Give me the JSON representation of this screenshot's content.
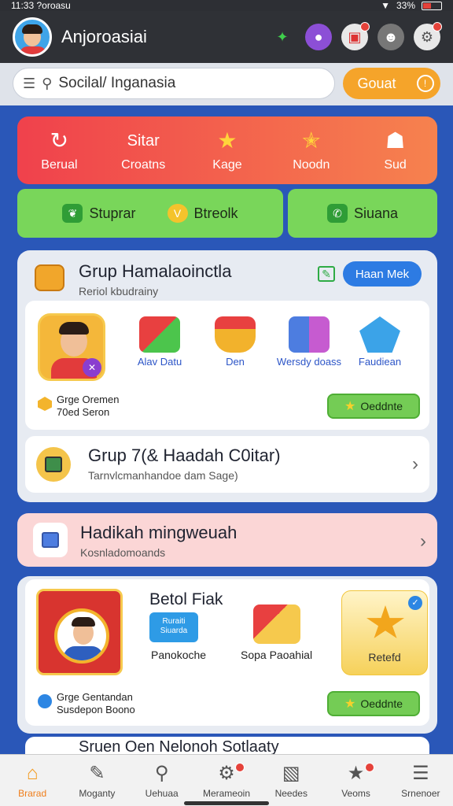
{
  "status": {
    "time": "11:33 ?oroasu",
    "battery": "33%"
  },
  "header": {
    "title": "Anjoroasiai"
  },
  "search": {
    "query": "Socilal/ Inganasia",
    "button_label": "Gouat"
  },
  "quick_actions": [
    {
      "label": "Berual",
      "icon": "refresh-icon"
    },
    {
      "label": "Croatns",
      "icon": "sitar-text",
      "top": "Sitar"
    },
    {
      "label": "Kage",
      "icon": "star-icon"
    },
    {
      "label": "Noodn",
      "icon": "sparkle-star-icon"
    },
    {
      "label": "Sud",
      "icon": "users-icon"
    }
  ],
  "green_buttons": [
    {
      "label": "Stuprar",
      "icon": "leaf-icon"
    },
    {
      "label": "Btreolk",
      "icon": "badge-icon"
    },
    {
      "label": "Siuana",
      "icon": "phone-icon"
    }
  ],
  "group_card": {
    "title": "Grup Hamalaoinctla",
    "subtitle": "Reriol kbudrainy",
    "action_label": "Haan Mek",
    "gifts": [
      {
        "label": "Alav Datu"
      },
      {
        "label": "Den"
      },
      {
        "label": "Wersdy doass"
      },
      {
        "label": "Faudiean"
      }
    ],
    "info_line1": "Grge Oremen",
    "info_line2": "70ed Seron",
    "check_label": "Oeddnte",
    "row": {
      "title": "Grup 7(& Haadah C0itar)",
      "subtitle": "Tarnvlcmanhandoe dam Sage)"
    }
  },
  "pink_row": {
    "title": "Hadikah mingweuah",
    "subtitle": "Kosnladomoands"
  },
  "bottom_card": {
    "title": "Betol Fiak",
    "badge_line1": "Ruraiti",
    "badge_line2": "Siuarda",
    "label1": "Panokoche",
    "label2": "Sopa Paoahial",
    "yellow_label": "Retefd",
    "info_line1": "Grge Gentandan",
    "info_line2": "Susdepon Boono",
    "check_label": "Oeddnte"
  },
  "partial_row": {
    "title": "Sruen Oen Nelonoh Sotlaaty"
  },
  "nav": [
    {
      "label": "Brarad",
      "icon": "home-icon",
      "active": true
    },
    {
      "label": "Moganty",
      "icon": "edit-icon"
    },
    {
      "label": "Uehuaa",
      "icon": "search-icon"
    },
    {
      "label": "Merameoin",
      "icon": "gear-icon"
    },
    {
      "label": "Needes",
      "icon": "chart-icon"
    },
    {
      "label": "Veoms",
      "icon": "star-icon"
    },
    {
      "label": "Srnenoer",
      "icon": "menu-icon"
    }
  ]
}
